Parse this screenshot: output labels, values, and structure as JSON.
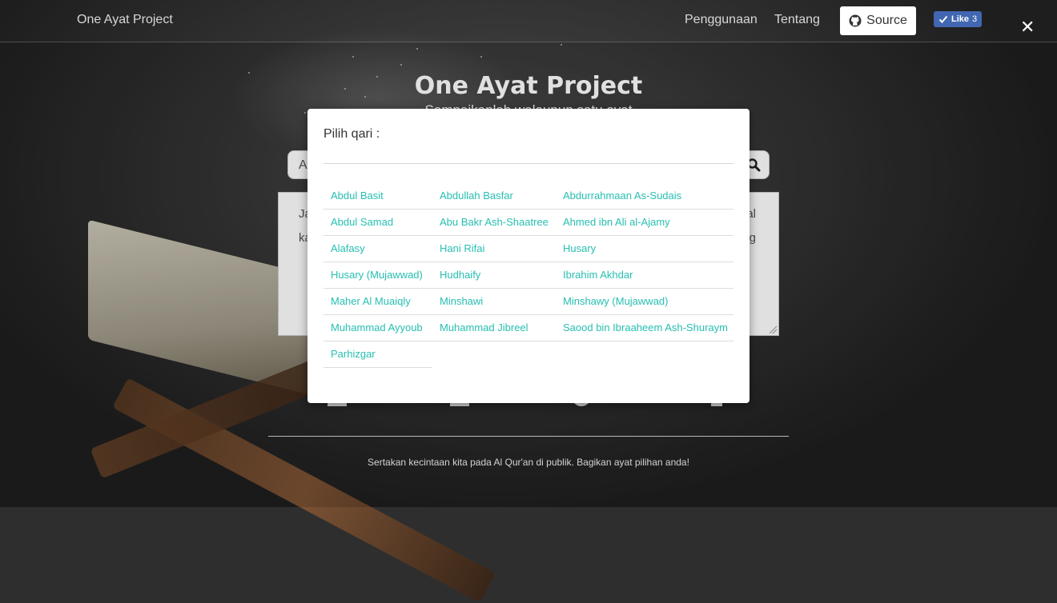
{
  "navbar": {
    "brand": "One Ayat Project",
    "links": [
      "Penggunaan",
      "Tentang"
    ],
    "source_label": "Source",
    "like_label": "Like",
    "like_count": "3"
  },
  "hero": {
    "title": "One Ayat Project",
    "subtitle": "Sampaikanlah walaupun satu ayat"
  },
  "search": {
    "value": "A"
  },
  "textarea": {
    "line1_start": "Ja",
    "line2_start": "ka",
    "line1_end": "al",
    "line2_end": "g"
  },
  "footer": {
    "text": "Sertakan kecintaan kita pada Al Qur'an di publik. Bagikan ayat pilihan anda!"
  },
  "modal": {
    "title": "Pilih qari :",
    "close_icon": "close-icon",
    "qari_list": [
      "Abdul Basit",
      "Abdullah Basfar",
      "Abdurrahmaan As-Sudais",
      "Abdul Samad",
      "Abu Bakr Ash-Shaatree",
      "Ahmed ibn Ali al-Ajamy",
      "Alafasy",
      "Hani Rifai",
      "Husary",
      "Husary (Mujawwad)",
      "Hudhaify",
      "Ibrahim Akhdar",
      "Maher Al Muaiqly",
      "Minshawi",
      "Minshawy (Mujawwad)",
      "Muhammad Ayyoub",
      "Muhammad Jibreel",
      "Saood bin Ibraaheem Ash-Shuraym",
      "Parhizgar"
    ]
  },
  "colors": {
    "link": "#27bfb2",
    "facebook": "#4267b2"
  }
}
